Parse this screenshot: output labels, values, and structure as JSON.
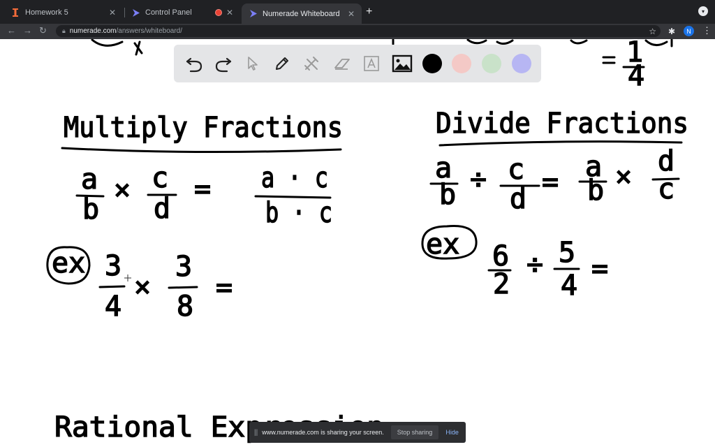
{
  "browser": {
    "tabs": [
      {
        "title": "Homework 5",
        "icon": "numerade-i-icon",
        "close": "✕"
      },
      {
        "title": "Control Panel",
        "icon": "numerade-play-icon",
        "close": "✕"
      },
      {
        "title": "Numerade Whiteboard",
        "icon": "numerade-play-icon",
        "close": "✕"
      }
    ],
    "new_tab": "+",
    "url_host": "numerade.com",
    "url_path": "/answers/whiteboard/",
    "profile_initial": "N"
  },
  "whiteboard": {
    "tools": [
      "undo-icon",
      "redo-icon",
      "select-arrow-icon",
      "pen-icon",
      "tools-icon",
      "eraser-icon",
      "text-icon",
      "image-icon"
    ],
    "colors": [
      "#000000",
      "#f4c9c6",
      "#c9e2c9",
      "#b7b6f3"
    ],
    "active_color": "#000000",
    "content": {
      "top_fraction_num": "1",
      "top_fraction_den": "4",
      "left_heading": "Multiply Fractions",
      "right_heading": "Divide Fractions",
      "bottom_heading": "Rational Expression",
      "left_rule": {
        "a": "a",
        "b": "b",
        "c": "c",
        "d": "d",
        "op": "×",
        "eq": "=",
        "rnum": "a · c",
        "rden": "b · c"
      },
      "right_rule": {
        "a": "a",
        "b": "b",
        "c": "c",
        "d": "d",
        "op": "÷",
        "eq": "=",
        "a2": "a",
        "b2": "b",
        "op2": "×",
        "d2": "d",
        "c2": "c"
      },
      "ex_label": "ex",
      "left_example": {
        "n1": "3",
        "d1": "4",
        "op": "×",
        "n2": "3",
        "d2": "8",
        "eq": "="
      },
      "right_example": {
        "n1": "6",
        "d1": "2",
        "op": "÷",
        "n2": "5",
        "d2": "4",
        "eq": "="
      }
    }
  },
  "share_bar": {
    "grip": "||",
    "message": "www.numerade.com is sharing your screen.",
    "stop_label": "Stop sharing",
    "hide_label": "Hide"
  }
}
